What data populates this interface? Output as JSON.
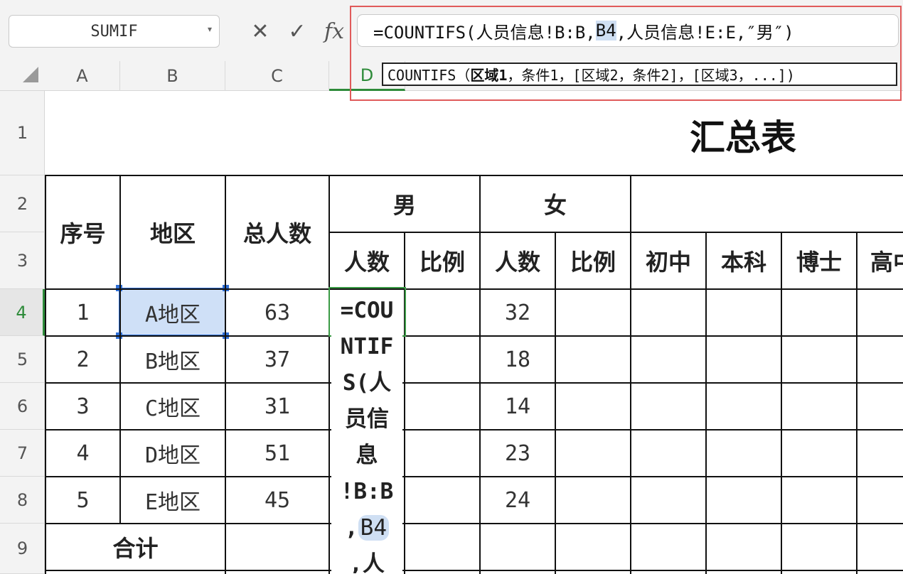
{
  "formula_bar": {
    "name_box": "SUMIF",
    "cancel_glyph": "✕",
    "enter_glyph": "✓",
    "fx_label": "fx",
    "formula_pre": "=COUNTIFS(人员信息!B:B,",
    "formula_ref": "B4",
    "formula_post": ",人员信息!E:E,″男″)"
  },
  "tooltip": {
    "func": "COUNTIFS（",
    "arg_bold": "区域1",
    "rest": "，条件1，[区域2，条件2]，[区域3，...])"
  },
  "columns": [
    "A",
    "B",
    "C",
    "D"
  ],
  "rows": [
    "1",
    "2",
    "3",
    "4",
    "5",
    "6",
    "7",
    "8",
    "9"
  ],
  "sheet": {
    "title": "汇总表",
    "headers": {
      "seq": "序号",
      "region": "地区",
      "total": "总人数",
      "male": "男",
      "female": "女",
      "count_m": "人数",
      "ratio_m": "比例",
      "count_f": "人数",
      "ratio_f": "比例",
      "edu_1": "初中",
      "edu_2": "本科",
      "edu_3": "博士",
      "edu_4": "高中"
    },
    "data": [
      {
        "seq": "1",
        "region": "A地区",
        "total": "63",
        "female": "32"
      },
      {
        "seq": "2",
        "region": "B地区",
        "total": "37",
        "female": "18"
      },
      {
        "seq": "3",
        "region": "C地区",
        "total": "31",
        "female": "14"
      },
      {
        "seq": "4",
        "region": "D地区",
        "total": "51",
        "female": "23"
      },
      {
        "seq": "5",
        "region": "E地区",
        "total": "45",
        "female": "24"
      }
    ],
    "sum_label": "合计",
    "editing_lines": [
      "=COU",
      "NTIF",
      "S(人",
      "员信",
      "息",
      "!B:B"
    ],
    "editing_ref": "B4",
    "editing_tail": [
      ",人"
    ]
  }
}
